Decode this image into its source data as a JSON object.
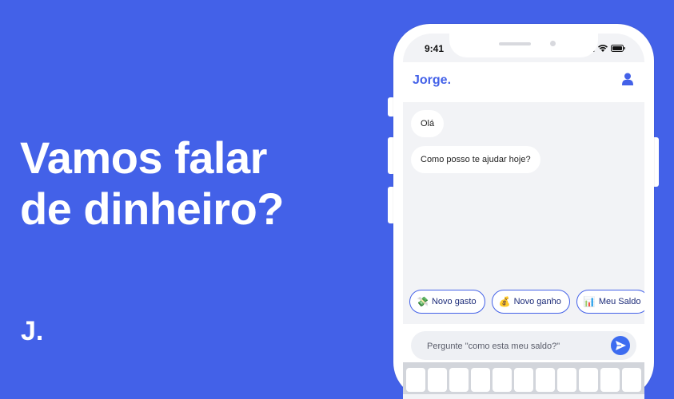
{
  "hero": {
    "headline_line1": "Vamos falar",
    "headline_line2": "de dinheiro?",
    "brand_mark": "J."
  },
  "phone": {
    "status_time": "9:41",
    "app_title": "Jorge.",
    "messages": [
      {
        "text": "Olá"
      },
      {
        "text": "Como posso te ajudar hoje?"
      }
    ],
    "quick_replies": [
      {
        "emoji": "💸",
        "label": "Novo gasto"
      },
      {
        "emoji": "💰",
        "label": "Novo ganho"
      },
      {
        "emoji": "📊",
        "label": "Meu Saldo"
      }
    ],
    "input_placeholder": "Pergunte \"como esta meu saldo?\"",
    "colors": {
      "background": "#4361e8",
      "accent": "#4361e8",
      "send": "#3d6cf0"
    }
  }
}
